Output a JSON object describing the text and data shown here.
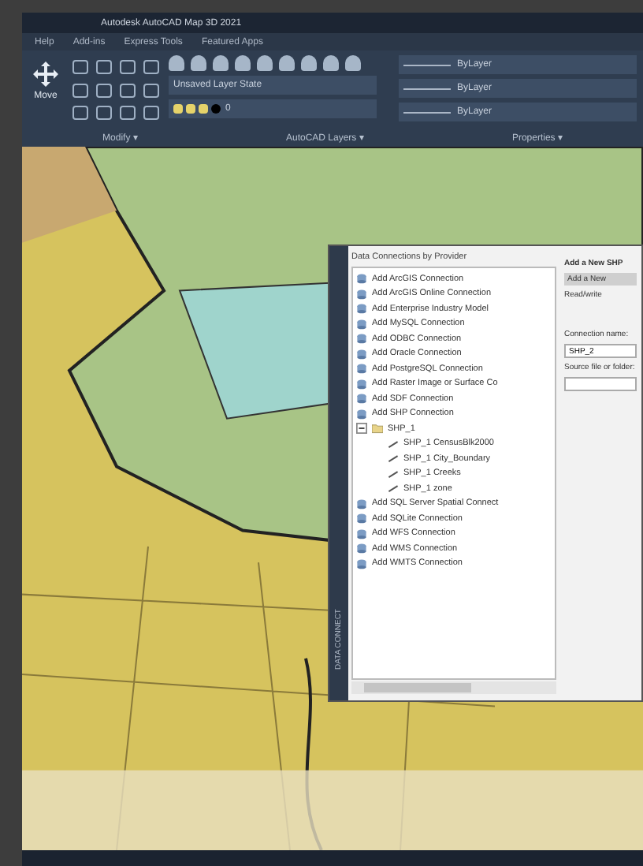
{
  "window": {
    "title": "Autodesk AutoCAD Map 3D 2021"
  },
  "menu": [
    "Help",
    "Add-ins",
    "Express Tools",
    "Featured Apps"
  ],
  "ribbon": {
    "move_label": "Move",
    "layer_state": "Unsaved Layer State",
    "layer": "0",
    "properties": [
      "ByLayer",
      "ByLayer",
      "ByLayer"
    ],
    "panels": [
      "Modify ▾",
      "AutoCAD Layers ▾",
      "Properties ▾"
    ]
  },
  "side_tab": "DATA CONNECT",
  "dialog": {
    "title": "Data Connections by Provider",
    "tree": [
      {
        "kind": "provider",
        "label": "Add ArcGIS Connection"
      },
      {
        "kind": "provider",
        "label": "Add ArcGIS Online Connection"
      },
      {
        "kind": "provider",
        "label": "Add Enterprise Industry Model"
      },
      {
        "kind": "provider",
        "label": "Add MySQL Connection"
      },
      {
        "kind": "provider",
        "label": "Add ODBC Connection"
      },
      {
        "kind": "provider",
        "label": "Add Oracle Connection"
      },
      {
        "kind": "provider",
        "label": "Add PostgreSQL Connection"
      },
      {
        "kind": "provider",
        "label": "Add Raster Image or Surface Co"
      },
      {
        "kind": "provider",
        "label": "Add SDF Connection"
      },
      {
        "kind": "provider",
        "label": "Add SHP Connection"
      },
      {
        "kind": "connection",
        "label": "SHP_1",
        "expanded": true,
        "children": [
          {
            "label": "SHP_1 CensusBlk2000"
          },
          {
            "label": "SHP_1 City_Boundary"
          },
          {
            "label": "SHP_1 Creeks"
          },
          {
            "label": "SHP_1 zone"
          }
        ]
      },
      {
        "kind": "provider",
        "label": "Add SQL Server Spatial Connect"
      },
      {
        "kind": "provider",
        "label": "Add SQLite Connection"
      },
      {
        "kind": "provider",
        "label": "Add WFS Connection"
      },
      {
        "kind": "provider",
        "label": "Add WMS Connection"
      },
      {
        "kind": "provider",
        "label": "Add WMTS Connection"
      }
    ],
    "right": {
      "heading": "Add a New SHP",
      "button": "Add a New",
      "description": "Read/write",
      "connection_label": "Connection name:",
      "connection_value": "SHP_2",
      "source_label": "Source file or folder:"
    }
  }
}
